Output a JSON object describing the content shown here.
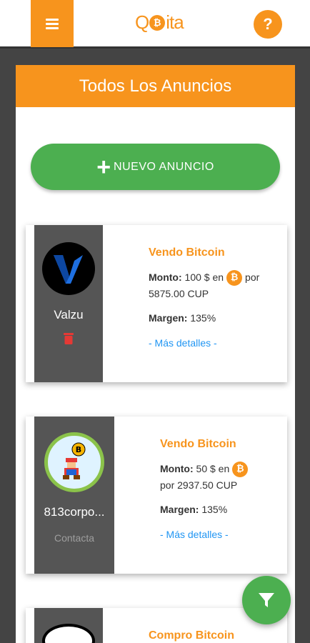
{
  "app": {
    "logo_left": "Q",
    "logo_coin": "₿",
    "logo_right": "ita",
    "help_label": "?"
  },
  "page": {
    "title": "Todos Los Anuncios",
    "new_ad_label": "NUEVO ANUNCIO"
  },
  "ads": [
    {
      "user": "Valzu",
      "title": "Vendo Bitcoin",
      "amount_label": "Monto:",
      "amount_text": "100 $ en",
      "coin": "₿",
      "price_pre": "por",
      "price": "5875.00 CUP",
      "margin_label": "Margen:",
      "margin": "135%",
      "details": "- Más detalles -"
    },
    {
      "user": "813corpo...",
      "contact": "Contacta",
      "title": "Vendo Bitcoin",
      "amount_label": "Monto:",
      "amount_text": "50 $ en",
      "coin": "₿",
      "price": "por 2937.50 CUP",
      "margin_label": "Margen:",
      "margin": "135%",
      "details": "- Más detalles -"
    },
    {
      "title": "Compro Bitcoin"
    }
  ],
  "icons": {
    "menu": "menu-icon",
    "help": "help-icon",
    "plus": "plus-icon",
    "delete": "trash-icon",
    "filter": "filter-icon"
  },
  "colors": {
    "accent": "#f7941d",
    "green": "#4caf50",
    "link": "#2196f3",
    "delete": "#e53935"
  }
}
